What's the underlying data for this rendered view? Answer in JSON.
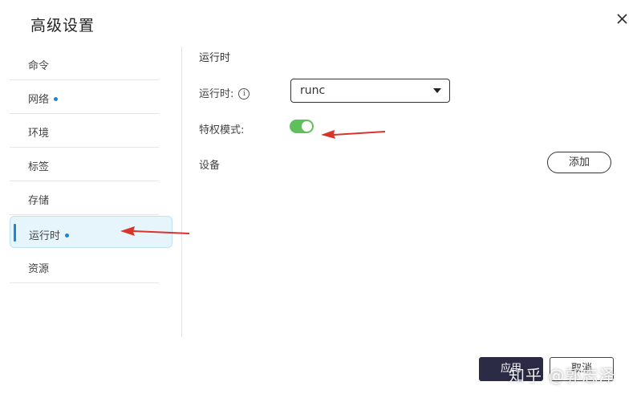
{
  "dialog": {
    "title": "高级设置",
    "close_label": "×"
  },
  "sidebar": {
    "items": [
      {
        "label": "命令",
        "dot": false,
        "active": false
      },
      {
        "label": "网络",
        "dot": true,
        "active": false
      },
      {
        "label": "环境",
        "dot": false,
        "active": false
      },
      {
        "label": "标签",
        "dot": false,
        "active": false
      },
      {
        "label": "存储",
        "dot": false,
        "active": false
      },
      {
        "label": "运行时",
        "dot": true,
        "active": true
      },
      {
        "label": "资源",
        "dot": false,
        "active": false
      }
    ]
  },
  "runtime_panel": {
    "section_title": "运行时",
    "runtime_label": "运行时:",
    "runtime_value": "runc",
    "privileged_label": "特权模式:",
    "privileged_enabled": true,
    "devices_label": "设备",
    "add_label": "添加"
  },
  "footer": {
    "apply_label": "应用",
    "cancel_label": "取消"
  },
  "watermark": "知乎 @郭志泽",
  "colors": {
    "accent": "#1a86d6",
    "toggle_on": "#5fbf5a",
    "primary_button": "#2b2b45",
    "annotation_arrow": "#d9342b"
  }
}
